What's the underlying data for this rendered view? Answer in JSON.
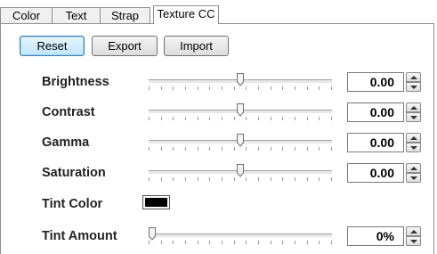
{
  "tabs": [
    {
      "label": "Color",
      "active": false
    },
    {
      "label": "Text",
      "active": false
    },
    {
      "label": "Strap",
      "active": false
    },
    {
      "label": "Texture CC",
      "active": true
    }
  ],
  "buttons": {
    "reset": "Reset",
    "export": "Export",
    "import": "Import"
  },
  "rows": [
    {
      "label": "Brightness",
      "value": "0.00",
      "level": 0.5
    },
    {
      "label": "Contrast",
      "value": "0.00",
      "level": 0.5
    },
    {
      "label": "Gamma",
      "value": "0.00",
      "level": 0.5
    },
    {
      "label": "Saturation",
      "value": "0.00",
      "level": 0.5
    }
  ],
  "tint_color": {
    "label": "Tint Color",
    "color": "#000000"
  },
  "tint_amount": {
    "label": "Tint Amount",
    "value": "0%",
    "level": 0.0
  }
}
